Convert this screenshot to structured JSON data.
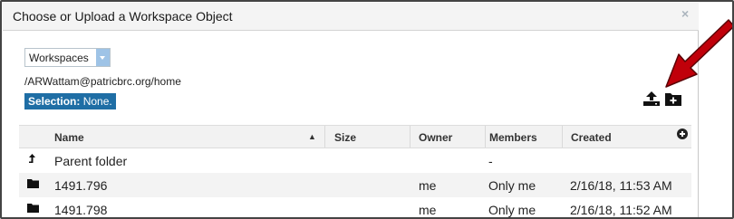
{
  "dialog": {
    "title": "Choose or Upload a Workspace Object",
    "close_glyph": "×"
  },
  "filter": {
    "selected": "Workspaces"
  },
  "current_path": "/ARWattam@patricbrc.org/home",
  "selection": {
    "label": "Selection:",
    "value": "None."
  },
  "toolbar": {
    "icons": [
      "upload-icon",
      "new-folder-icon"
    ]
  },
  "annotation": {
    "color": "#c0000a"
  },
  "grid": {
    "columns": [
      "Name",
      "Size",
      "Owner",
      "Members",
      "Created"
    ],
    "rows": [
      {
        "icon": "up-arrow-icon",
        "name": "Parent folder",
        "size": "",
        "owner": "",
        "members": "-",
        "created": ""
      },
      {
        "icon": "folder-icon",
        "name": "1491.796",
        "size": "",
        "owner": "me",
        "members": "Only me",
        "created": "2/16/18, 11:53 AM"
      },
      {
        "icon": "folder-icon",
        "name": "1491.798",
        "size": "",
        "owner": "me",
        "members": "Only me",
        "created": "2/16/18, 11:52 AM"
      }
    ]
  },
  "colors": {
    "selection_bg": "#1f6ea5",
    "select_arrow": "#9ec3e6",
    "header_bg": "#f2f2f2"
  }
}
